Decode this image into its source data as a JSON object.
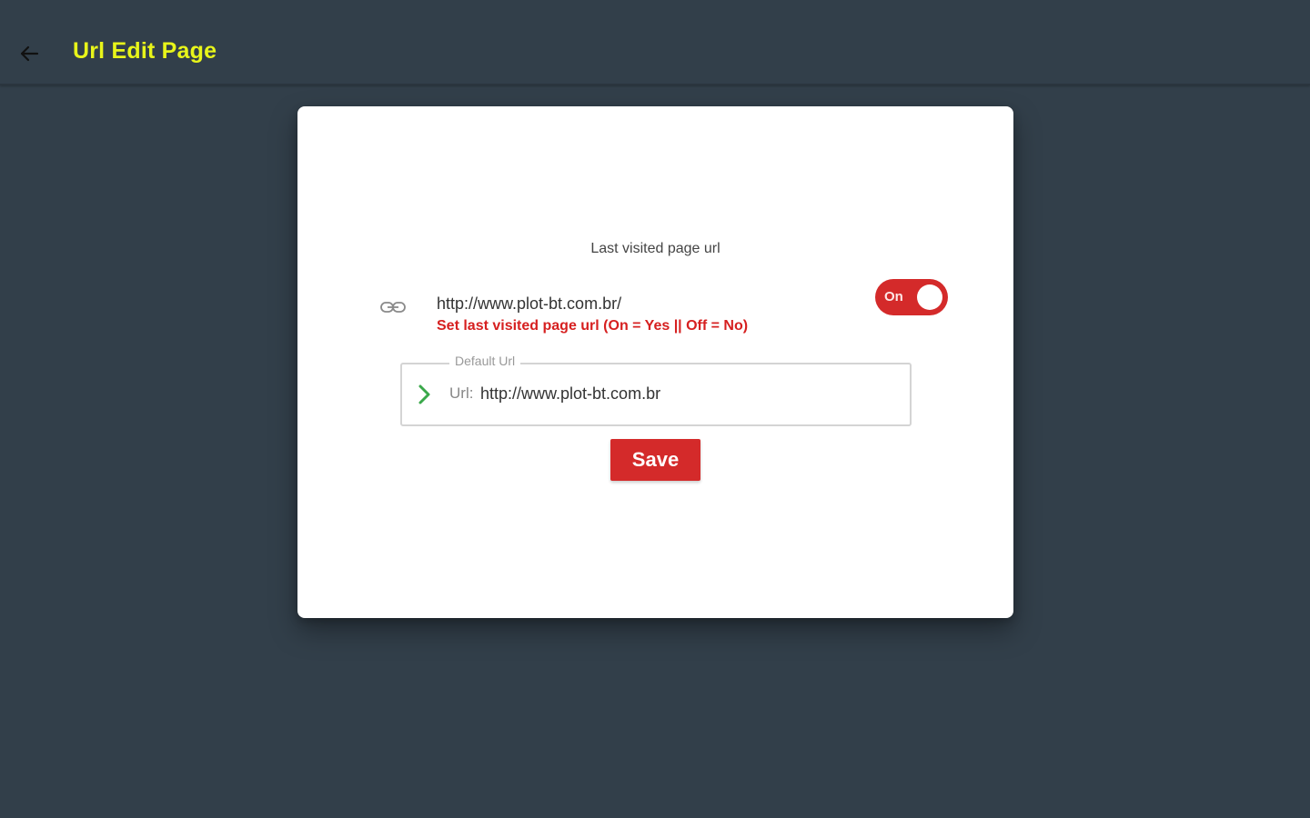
{
  "header": {
    "title": "Url Edit Page",
    "back_icon": "arrow-left-icon",
    "title_color": "#e8f51a",
    "background": "#323f4a"
  },
  "card": {
    "section_title": "Last visited page url",
    "last_visited": {
      "icon": "link-icon",
      "url": "http://www.plot-bt.com.br/",
      "hint": "Set last visited page url (On = Yes || Off = No)",
      "hint_color": "#d62020",
      "toggle": {
        "label": "On",
        "state": true,
        "color": "#d42a2a"
      }
    },
    "default_url": {
      "legend": "Default Url",
      "icon": "chevron-right-icon",
      "icon_color": "#3aa84a",
      "prefix": "Url:",
      "value": "http://www.plot-bt.com.br"
    },
    "save_label": "Save",
    "save_color": "#d42a2a"
  }
}
